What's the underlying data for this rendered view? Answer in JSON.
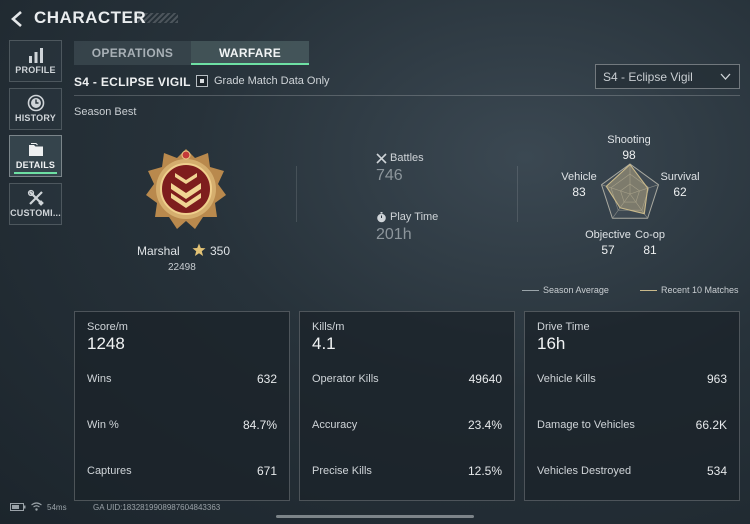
{
  "header": {
    "title": "CHARACTER"
  },
  "sidebar": {
    "items": [
      {
        "label": "PROFILE",
        "icon": "bar-chart-icon"
      },
      {
        "label": "HISTORY",
        "icon": "clock-icon"
      },
      {
        "label": "DETAILS",
        "icon": "folder-icon",
        "active": true
      },
      {
        "label": "CUSTOMI...",
        "icon": "tools-icon"
      }
    ]
  },
  "tabs": [
    {
      "label": "OPERATIONS",
      "active": false
    },
    {
      "label": "WARFARE",
      "active": true
    }
  ],
  "season": {
    "title": "S4 - ECLIPSE VIGIL",
    "grade_match_label": "Grade Match Data Only",
    "grade_match_checked": false,
    "select_value": "S4 - Eclipse Vigil"
  },
  "season_best": {
    "label": "Season Best",
    "rank_name": "Marshal",
    "rank_points": "350",
    "rank_score": "22498",
    "battles_label": "Battles",
    "battles_value": "746",
    "playtime_label": "Play Time",
    "playtime_value": "201h"
  },
  "radar": {
    "shooting_label": "Shooting",
    "shooting_value": "98",
    "survival_label": "Survival",
    "survival_value": "62",
    "coop_label": "Co-op",
    "coop_value": "81",
    "objective_label": "Objective",
    "objective_value": "57",
    "vehicle_label": "Vehicle",
    "vehicle_value": "83",
    "legend_avg": "Season Average",
    "legend_recent": "Recent 10 Matches",
    "colors": {
      "avg": "#9aa4aa",
      "recent": "#c9b98b"
    }
  },
  "cards": [
    {
      "header_label": "Score/m",
      "header_value": "1248",
      "rows": [
        {
          "label": "Wins",
          "value": "632"
        },
        {
          "label": "Win %",
          "value": "84.7%"
        },
        {
          "label": "Captures",
          "value": "671"
        }
      ]
    },
    {
      "header_label": "Kills/m",
      "header_value": "4.1",
      "rows": [
        {
          "label": "Operator Kills",
          "value": "49640"
        },
        {
          "label": "Accuracy",
          "value": "23.4%"
        },
        {
          "label": "Precise Kills",
          "value": "12.5%"
        }
      ]
    },
    {
      "header_label": "Drive Time",
      "header_value": "16h",
      "rows": [
        {
          "label": "Vehicle Kills",
          "value": "963"
        },
        {
          "label": "Damage to Vehicles",
          "value": "66.2K"
        },
        {
          "label": "Vehicles Destroyed",
          "value": "534"
        }
      ]
    }
  ],
  "footer": {
    "ping": "54ms",
    "uid": "GA UID:1832819908987604843363"
  },
  "colors": {
    "accent": "#6ee0a4"
  }
}
